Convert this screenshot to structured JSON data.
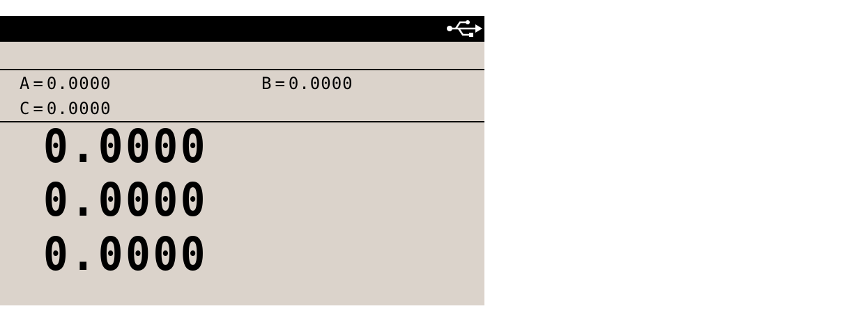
{
  "status_bar": {
    "usb_icon": "usb-icon"
  },
  "coefficients": {
    "a_label": "A",
    "a_value": "0.0000",
    "b_label": "B",
    "b_value": "0.0000",
    "c_label": "C",
    "c_value": "0.0000",
    "equals": "="
  },
  "readings": [
    {
      "value": "0.0000"
    },
    {
      "value": "0.0000"
    },
    {
      "value": "0.0000"
    }
  ],
  "colors": {
    "screen_background": "#dbd3cb",
    "ink": "#000000",
    "page_background": "#ffffff"
  }
}
